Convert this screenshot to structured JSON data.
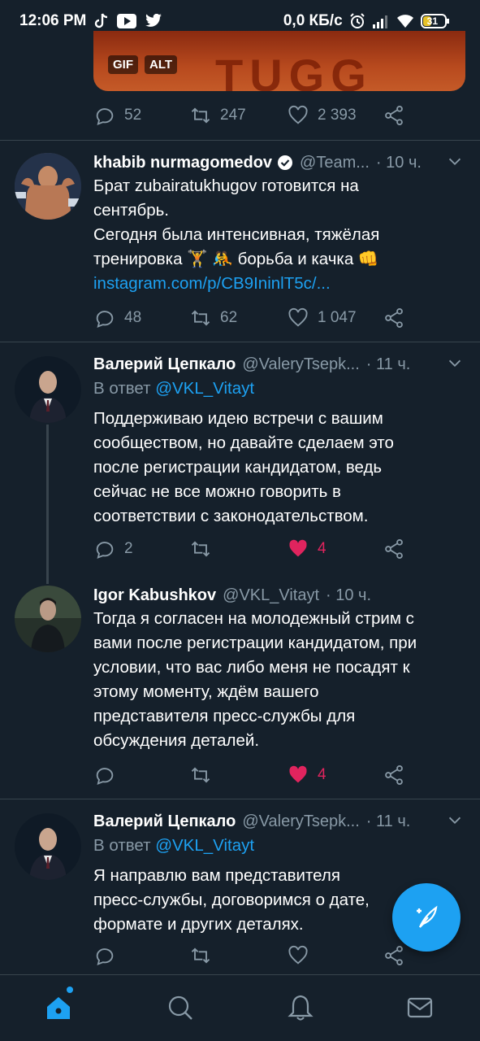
{
  "status_bar": {
    "time": "12:06 PM",
    "network_speed": "0,0 КБ/с",
    "battery": "31"
  },
  "media": {
    "badge_gif": "GIF",
    "badge_alt": "ALT",
    "art_text": "TUGG"
  },
  "prev_tweet": {
    "replies": "52",
    "retweets": "247",
    "likes": "2 393"
  },
  "tweets": [
    {
      "name": "khabib nurmagomedov",
      "handle": "@Team...",
      "time": "· 10 ч.",
      "verified": true,
      "lines": [
        "Брат zubairatukhugov готовится на",
        "сентябрь.",
        "Сегодня была интенсивная, тяжёлая",
        "тренировка 🏋 🤼 борьба и качка 👊"
      ],
      "link": "instagram.com/p/CB9IninlT5c/...",
      "replies": "48",
      "retweets": "62",
      "likes": "1 047"
    },
    {
      "name": "Валерий Цепкало",
      "handle": "@ValeryTsepk...",
      "time": "· 11 ч.",
      "reply_prefix": "В ответ",
      "reply_mention": "@VKL_Vitayt",
      "lines": [
        "Поддерживаю идею встречи с вашим",
        "сообществом, но давайте сделаем это",
        "после регистрации кандидатом, ведь",
        "сейчас не все можно говорить в",
        "соответствии с законодательством."
      ],
      "replies": "2",
      "retweets": "",
      "likes": "4"
    },
    {
      "name": "Igor Kabushkov",
      "handle": "@VKL_Vitayt",
      "time": "· 10 ч.",
      "lines": [
        "Тогда я согласен на молодежный стрим с",
        "вами после регистрации кандидатом, при",
        "условии, что вас либо меня не посадят к",
        "этому моменту, ждём вашего",
        "представителя пресс-службы для",
        "обсуждения деталей."
      ],
      "replies": "",
      "retweets": "",
      "likes": "4"
    },
    {
      "name": "Валерий Цепкало",
      "handle": "@ValeryTsepk...",
      "time": "· 11 ч.",
      "reply_prefix": "В ответ",
      "reply_mention": "@VKL_Vitayt",
      "lines": [
        "Я направлю вам представителя",
        "пресс-службы, договоримся о дате,",
        "формате и других деталях."
      ],
      "replies": "",
      "retweets": "",
      "likes": ""
    }
  ],
  "colors": {
    "background": "#15202b",
    "accent": "#1da1f2",
    "muted": "#8899a6",
    "like": "#e0245e",
    "divider": "#38444d"
  },
  "icons": {
    "reply": "reply-icon",
    "retweet": "retweet-icon",
    "like": "heart-icon",
    "share": "share-icon",
    "compose": "compose-tweet-icon",
    "home": "home-icon",
    "search": "search-icon",
    "notifications": "bell-icon",
    "messages": "mail-icon"
  }
}
